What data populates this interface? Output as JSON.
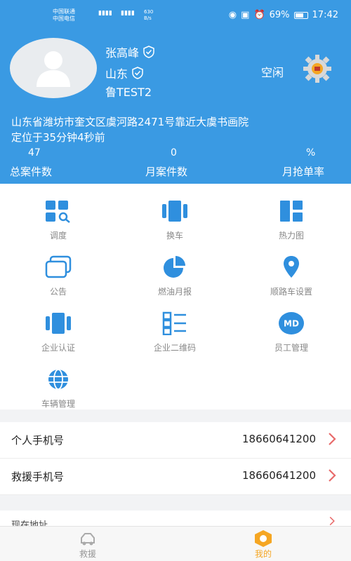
{
  "status_bar": {
    "carrier1": "中国联通",
    "carrier2": "中国电信",
    "net_speed": "630\nB/s",
    "battery": "69%",
    "time": "17:42"
  },
  "profile": {
    "name": "张高峰",
    "region": "山东",
    "plate": "鲁TEST2",
    "status": "空闲",
    "address": "山东省潍坊市奎文区虞河路2471号靠近大虞书画院",
    "located": "定位于35分钟4秒前"
  },
  "stats": [
    {
      "value": "47",
      "label": "总案件数"
    },
    {
      "value": "0",
      "label": "月案件数"
    },
    {
      "value": "%",
      "label": "月抢单率"
    }
  ],
  "menu": [
    {
      "label": "调度",
      "icon": "dispatch-icon"
    },
    {
      "label": "换车",
      "icon": "switch-car-icon"
    },
    {
      "label": "热力图",
      "icon": "heatmap-icon"
    },
    {
      "label": "公告",
      "icon": "notice-icon"
    },
    {
      "label": "燃油月报",
      "icon": "pie-chart-icon"
    },
    {
      "label": "顺路车设置",
      "icon": "location-pin-icon"
    },
    {
      "label": "企业认证",
      "icon": "certification-icon"
    },
    {
      "label": "企业二维码",
      "icon": "qr-list-icon"
    },
    {
      "label": "员工管理",
      "icon": "md-badge-icon",
      "badge": "MD"
    },
    {
      "label": "车辆管理",
      "icon": "globe-icon"
    }
  ],
  "rows": [
    {
      "label": "个人手机号",
      "value": "18660641200"
    },
    {
      "label": "救援手机号",
      "value": "18660641200"
    }
  ],
  "partial_row_label": "现在地址",
  "tabs": [
    {
      "label": "救援"
    },
    {
      "label": "我的"
    }
  ],
  "colors": {
    "primary": "#3a9ae3",
    "accent": "#f5a623",
    "chevron": "#e86a6a"
  }
}
